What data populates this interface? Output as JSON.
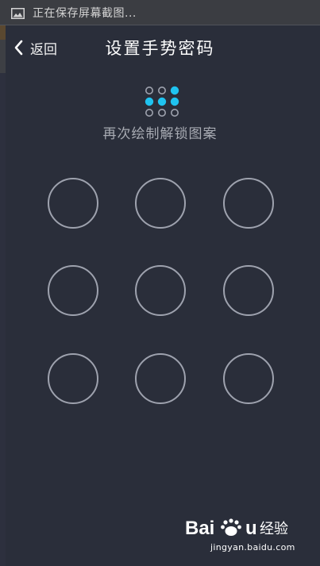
{
  "status_bar": {
    "text": "正在保存屏幕截图..."
  },
  "header": {
    "back_label": "返回",
    "title": "设置手势密码"
  },
  "hint": "再次绘制解锁图案",
  "preview_pattern": {
    "active_color": "#1fc3f0",
    "inactive_color": "#9ea2ae",
    "active_dots": [
      2,
      3,
      4,
      5
    ]
  },
  "grid": {
    "rows": 3,
    "cols": 3,
    "ring_color": "#9ea2ae"
  },
  "watermark": {
    "brand": "Baidu",
    "subtitle": "经验",
    "url": "jingyan.baidu.com"
  }
}
